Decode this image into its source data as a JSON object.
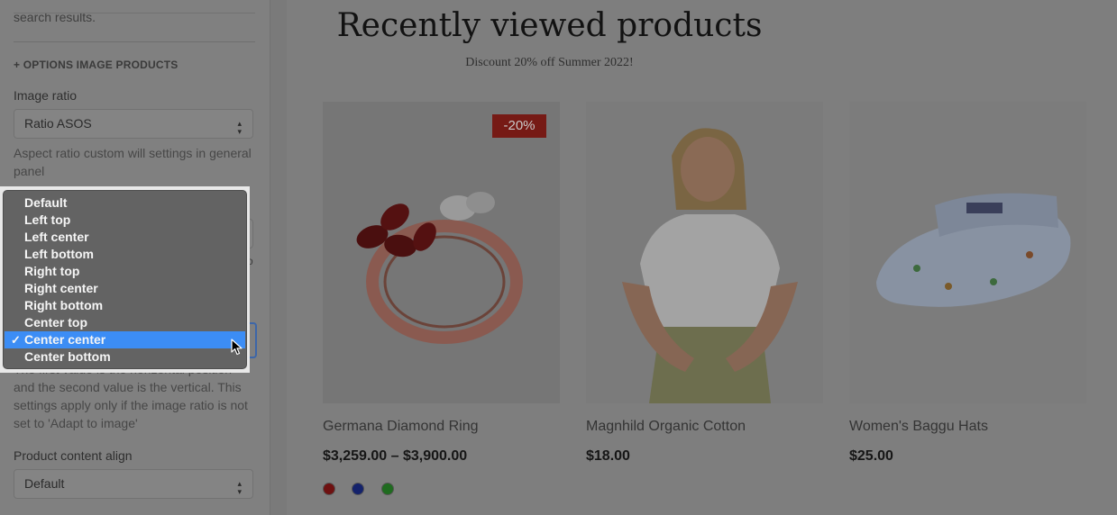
{
  "sidebar": {
    "clipped_text": "search results.",
    "section_heading": "+ OPTIONS IMAGE PRODUCTS",
    "image_ratio": {
      "label": "Image ratio",
      "value": "Ratio ASOS",
      "help": "Aspect ratio custom will settings in general panel"
    },
    "position_help": "The first value is the horizontal position and the second value is the vertical. This settings apply only if the image ratio is not set to 'Adapt to image'",
    "content_align": {
      "label": "Product content align",
      "value": "Default"
    }
  },
  "dropdown": {
    "options": [
      "Default",
      "Left top",
      "Left center",
      "Left bottom",
      "Right top",
      "Right center",
      "Right bottom",
      "Center top",
      "Center center",
      "Center bottom"
    ],
    "selected": "Center center",
    "check_glyph": "✓"
  },
  "main": {
    "title": "Recently viewed products",
    "subtitle": "Discount 20% off Summer 2022!",
    "products": [
      {
        "name": "Germana Diamond Ring",
        "price": "$3,259.00 – $3,900.00",
        "badge": "-20%",
        "swatches": [
          "#6e1010",
          "#14226b",
          "#1f6b1f"
        ]
      },
      {
        "name": "Magnhild Organic Cotton",
        "price": "$18.00"
      },
      {
        "name": "Women's Baggu Hats",
        "price": "$25.00"
      }
    ]
  },
  "colors": {
    "accent": "#3c8df5",
    "badge": "#761a15",
    "overlay_bg": "#7e7e7e"
  }
}
